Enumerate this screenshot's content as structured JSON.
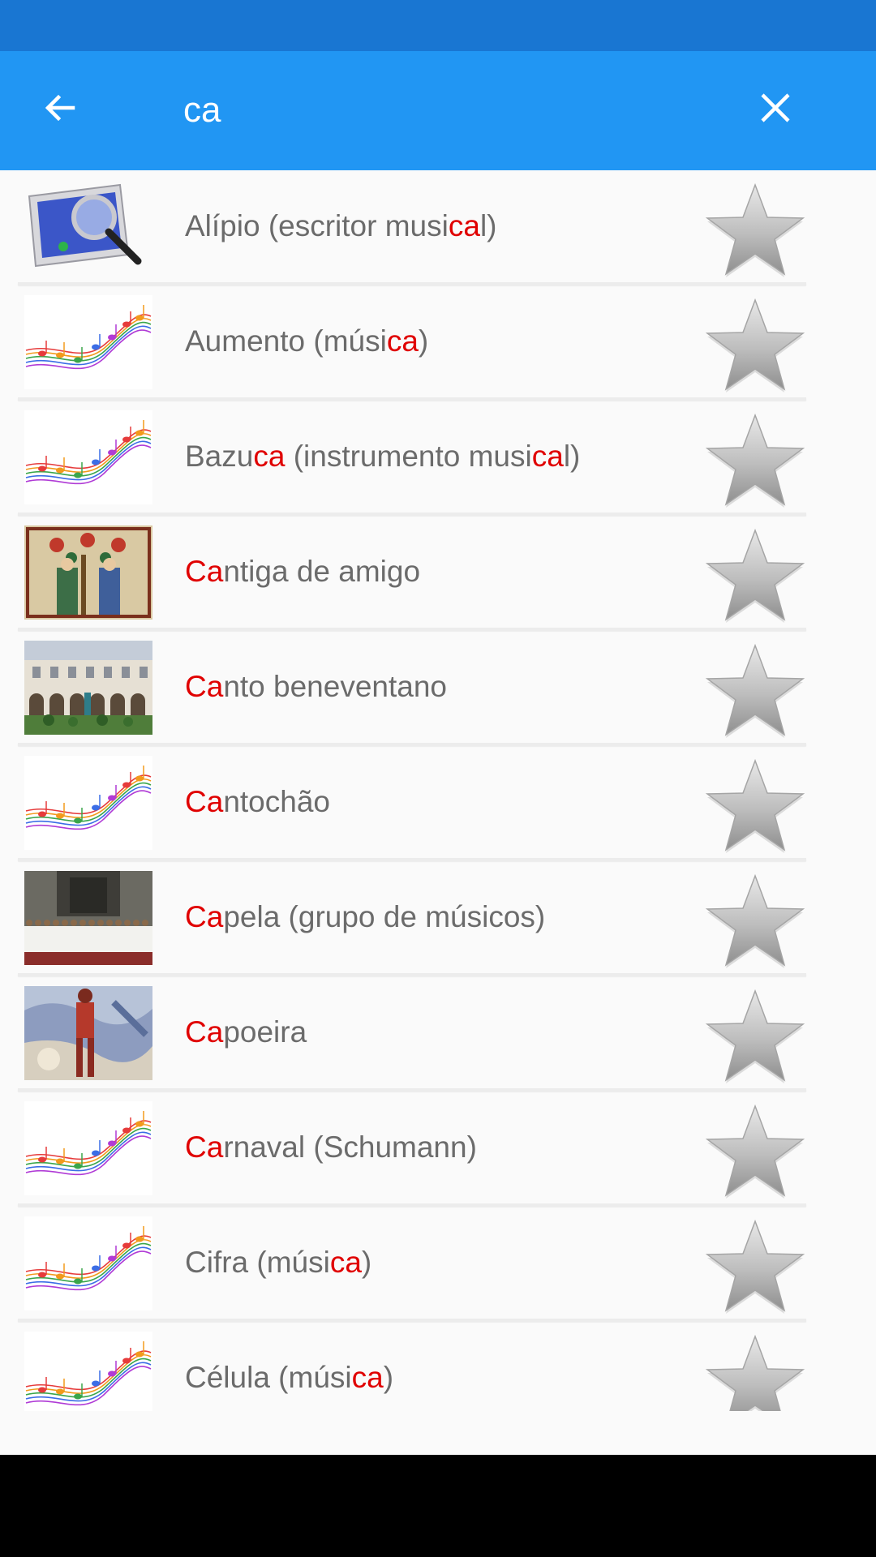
{
  "search": {
    "query": "ca"
  },
  "results": [
    {
      "thumb": "search-app-icon",
      "pre": "Alípio (escritor musi",
      "hl": "ca",
      "post": "l)"
    },
    {
      "thumb": "music-notes",
      "pre": "Aumento (músi",
      "hl": "ca",
      "post": ")"
    },
    {
      "thumb": "music-notes",
      "pre": "Bazu",
      "hl": "ca",
      "post": " (instrumento musi",
      "hl2": "ca",
      "post2": "l)"
    },
    {
      "thumb": "medieval-painting",
      "pre": "",
      "hl": "Ca",
      "post": "ntiga de amigo"
    },
    {
      "thumb": "cloister-photo",
      "pre": "",
      "hl": "Ca",
      "post": "nto beneventano"
    },
    {
      "thumb": "music-notes",
      "pre": "",
      "hl": "Ca",
      "post": "ntochão"
    },
    {
      "thumb": "choir-photo",
      "pre": "",
      "hl": "Ca",
      "post": "pela (grupo de músicos)"
    },
    {
      "thumb": "capoeira-painting",
      "pre": "",
      "hl": "Ca",
      "post": "poeira"
    },
    {
      "thumb": "music-notes",
      "pre": "",
      "hl": "Ca",
      "post": "rnaval (Schumann)"
    },
    {
      "thumb": "music-notes",
      "pre": "Cifra (músi",
      "hl": "ca",
      "post": ")"
    },
    {
      "thumb": "music-notes",
      "pre": "Célula (músi",
      "hl": "ca",
      "post": ")"
    }
  ],
  "colors": {
    "app_bar": "#2196f3",
    "status_bar": "#1976d2",
    "highlight": "#e00000",
    "text": "#6b6b6b"
  },
  "icons": {
    "back": "arrow-left-icon",
    "clear": "close-icon",
    "favorite": "star-icon"
  }
}
